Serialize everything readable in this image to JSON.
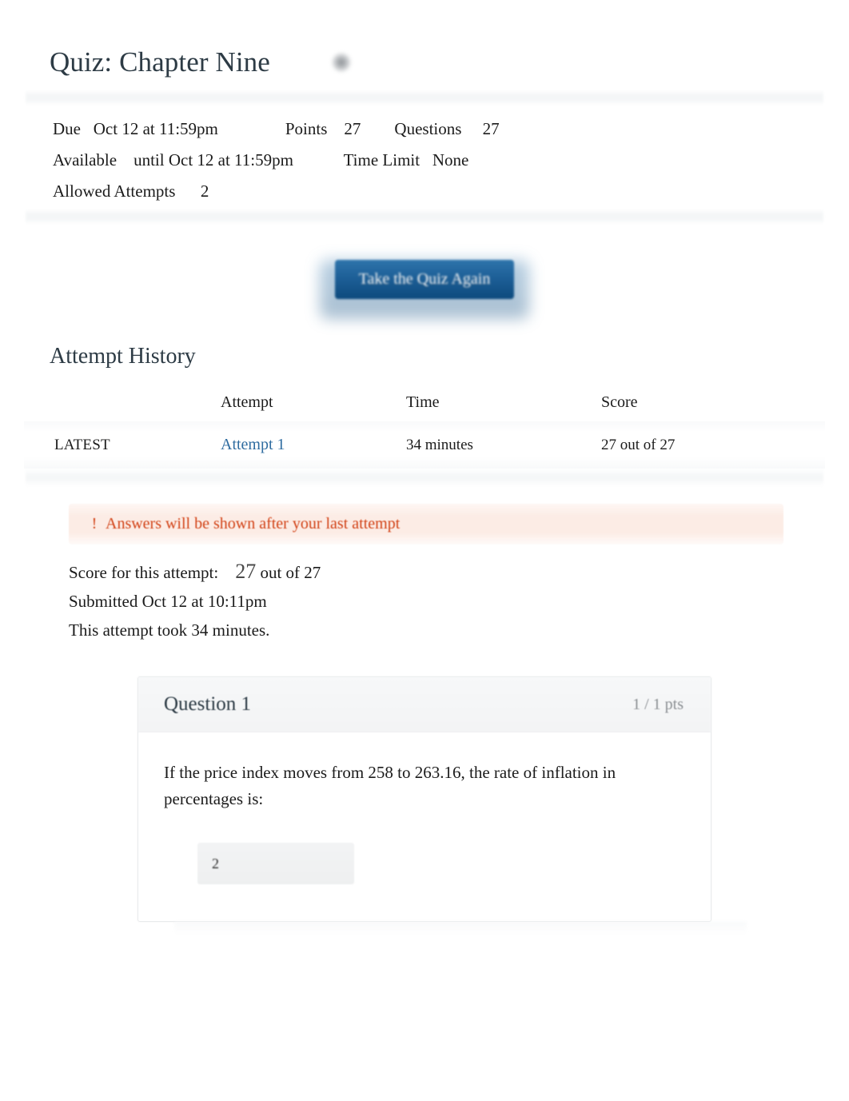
{
  "header": {
    "quiz_title": "Quiz: Chapter Nine",
    "publish_icon": "published-check-icon"
  },
  "meta": {
    "due_label": "Due",
    "due_value": "Oct 12 at 11:59pm",
    "points_label": "Points",
    "points_value": "27",
    "questions_label": "Questions",
    "questions_value": "27",
    "available_label": "Available",
    "available_value": "until Oct 12 at 11:59pm",
    "time_limit_label": "Time Limit",
    "time_limit_value": "None",
    "allowed_attempts_label": "Allowed Attempts",
    "allowed_attempts_value": "2"
  },
  "actions": {
    "take_quiz_again": "Take the Quiz Again"
  },
  "attempt_history": {
    "section_title": "Attempt History",
    "columns": {
      "blank": "",
      "attempt": "Attempt",
      "time": "Time",
      "score": "Score"
    },
    "rows": [
      {
        "latest": "LATEST",
        "attempt": "Attempt 1",
        "time": "34 minutes",
        "score": "27 out of 27"
      }
    ]
  },
  "alert": {
    "icon": "exclamation-icon",
    "icon_glyph": "!",
    "text": "Answers will be shown after your last attempt",
    "color": "#d24317",
    "background": "#fcebe4"
  },
  "attempt_summary": {
    "score_label": "Score for this attempt:",
    "score_value": "27",
    "score_suffix": "out of 27",
    "submitted": "Submitted Oct 12 at 10:11pm",
    "duration": "This attempt took 34 minutes."
  },
  "question": {
    "name": "Question 1",
    "points": "1 / 1 pts",
    "text": "If the price index moves from 258 to 263.16, the rate of inflation in percentages is:",
    "answer_value": "2"
  },
  "colors": {
    "link": "#2f6ca0",
    "button_top": "#2e74ab",
    "button_bottom": "#0d4a7d",
    "text": "#1b1b1b",
    "muted": "#8b8f93"
  }
}
